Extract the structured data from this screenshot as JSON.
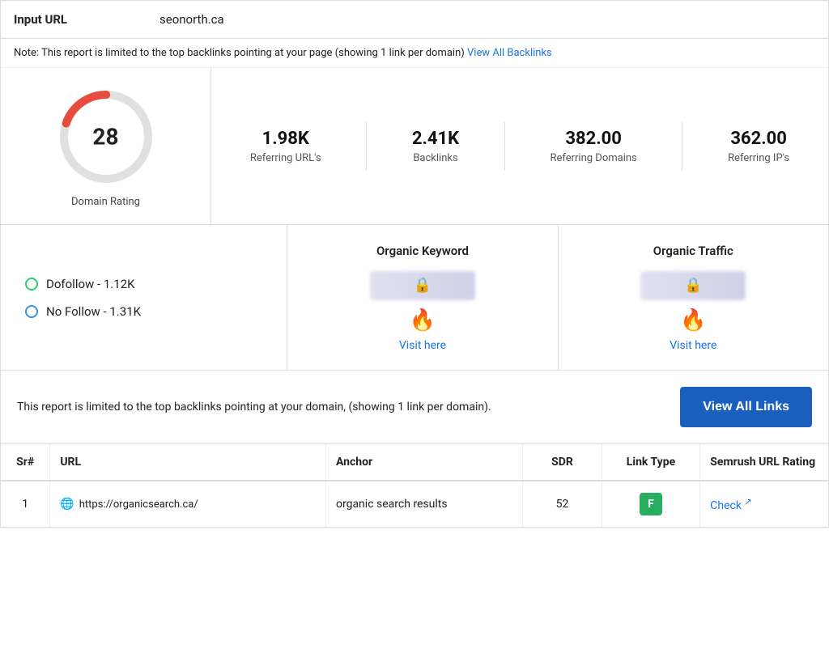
{
  "header": {
    "input_url_label": "Input URL",
    "input_url_value": "seonorth.ca"
  },
  "note": {
    "text": "Note: This report is limited to the top backlinks pointing at your page (showing 1 link per domain)",
    "link_label": "View All Backlinks",
    "link_href": "#"
  },
  "domain_rating": {
    "value": 28,
    "label": "Domain Rating"
  },
  "metrics": [
    {
      "value": "1.98K",
      "label": "Referring URL's"
    },
    {
      "value": "2.41K",
      "label": "Backlinks"
    },
    {
      "value": "382.00",
      "label": "Referring Domains"
    },
    {
      "value": "362.00",
      "label": "Referring IP's"
    }
  ],
  "link_types": {
    "dofollow": "Dofollow - 1.12K",
    "nofollow": "No Follow - 1.31K"
  },
  "organic_keyword": {
    "title": "Organic Keyword",
    "visit_label": "Visit here",
    "visit_href": "#"
  },
  "organic_traffic": {
    "title": "Organic Traffic",
    "visit_label": "Visit here",
    "visit_href": "#"
  },
  "report_bar": {
    "text": "This report is limited to the top backlinks pointing at your domain, (showing 1 link per domain).",
    "button_label": "View All Links"
  },
  "table": {
    "columns": [
      "Sr#",
      "URL",
      "Anchor",
      "SDR",
      "Link Type",
      "Semrush URL Rating"
    ],
    "rows": [
      {
        "sr": "1",
        "url": "https://organicsearch.ca/",
        "anchor": "organic search results",
        "sdr": "52",
        "link_type": "F",
        "semrush": "Check"
      }
    ]
  }
}
